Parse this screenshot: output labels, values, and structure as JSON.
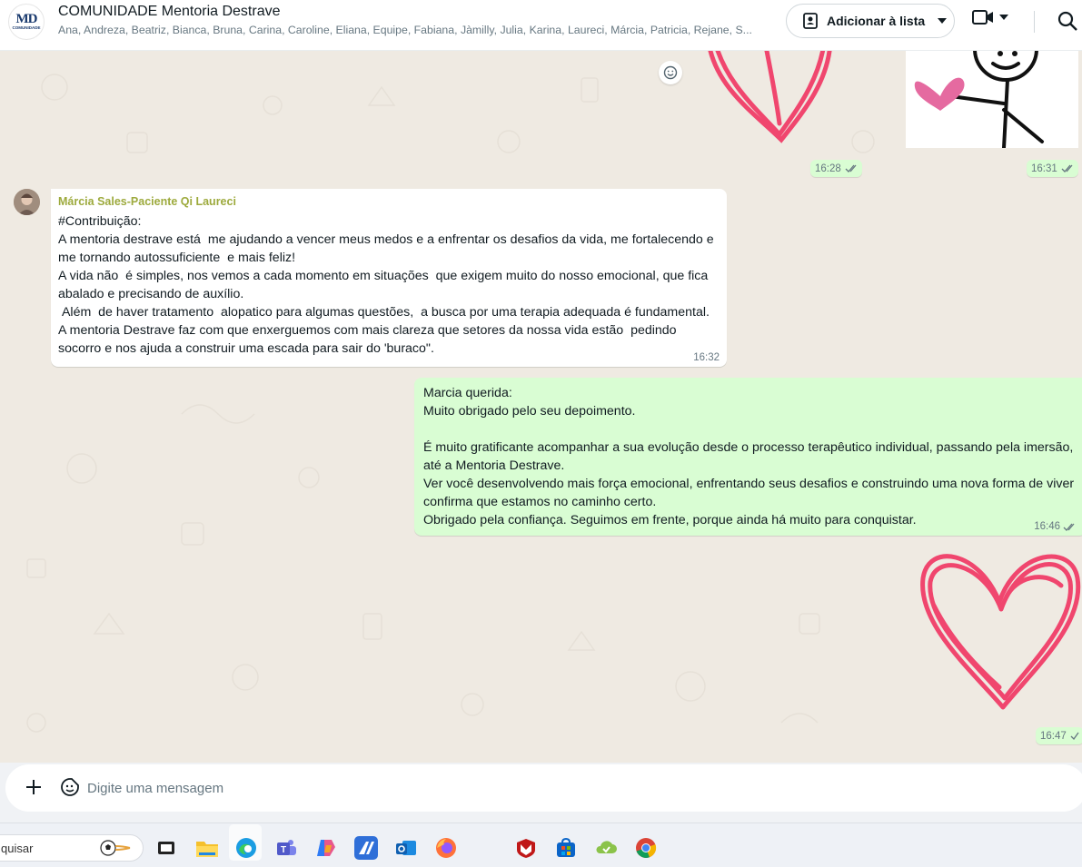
{
  "header": {
    "logo_text": "MD",
    "logo_sub": "COMUNIDADE",
    "title": "COMUNIDADE Mentoria Destrave",
    "members": "Ana, Andreza, Beatriz, Bianca, Bruna, Carina, Caroline, Eliana, Equipe, Fabiana, Jàmilly, Julia, Karina, Laureci, Márcia, Patricia, Rejane, S...",
    "add_list_label": "Adicionar à lista"
  },
  "chat": {
    "top_times": [
      "16:28",
      "16:31"
    ],
    "incoming": {
      "sender": "Márcia Sales-Paciente Qi Laureci",
      "text": "#Contribuição:\nA mentoria destrave está  me ajudando a vencer meus medos e a enfrentar os desafios da vida, me fortalecendo e me tornando autossuficiente  e mais feliz!\nA vida não  é simples, nos vemos a cada momento em situações  que exigem muito do nosso emocional, que fica abalado e precisando de auxílio.\n Além  de haver tratamento  alopatico para algumas questões,  a busca por uma terapia adequada é fundamental.\nA mentoria Destrave faz com que enxerguemos com mais clareza que setores da nossa vida estão  pedindo socorro e nos ajuda a construir uma escada para sair do 'buraco\".",
      "time": "16:32"
    },
    "outgoing": {
      "text": "Marcia querida:\nMuito obrigado pelo seu depoimento.\n\nÉ muito gratificante acompanhar a sua evolução desde o processo terapêutico individual, passando pela imersão, até a Mentoria Destrave.\nVer você desenvolvendo mais força emocional, enfrentando seus desafios e construindo uma nova forma de viver confirma que estamos no caminho certo.\nObrigado pela confiança. Seguimos em frente, porque ainda há muito para conquistar.",
      "time": "16:46"
    },
    "sticker_time": "16:47"
  },
  "composer": {
    "placeholder": "Digite uma mensagem"
  },
  "taskbar": {
    "search_text": "quisar"
  },
  "colors": {
    "chat_bg": "#efeae2",
    "outgoing_bubble": "#d9fdd3",
    "sender_name": "#9daa3d",
    "read_ticks": "#667781",
    "heart": "#f0466e"
  }
}
